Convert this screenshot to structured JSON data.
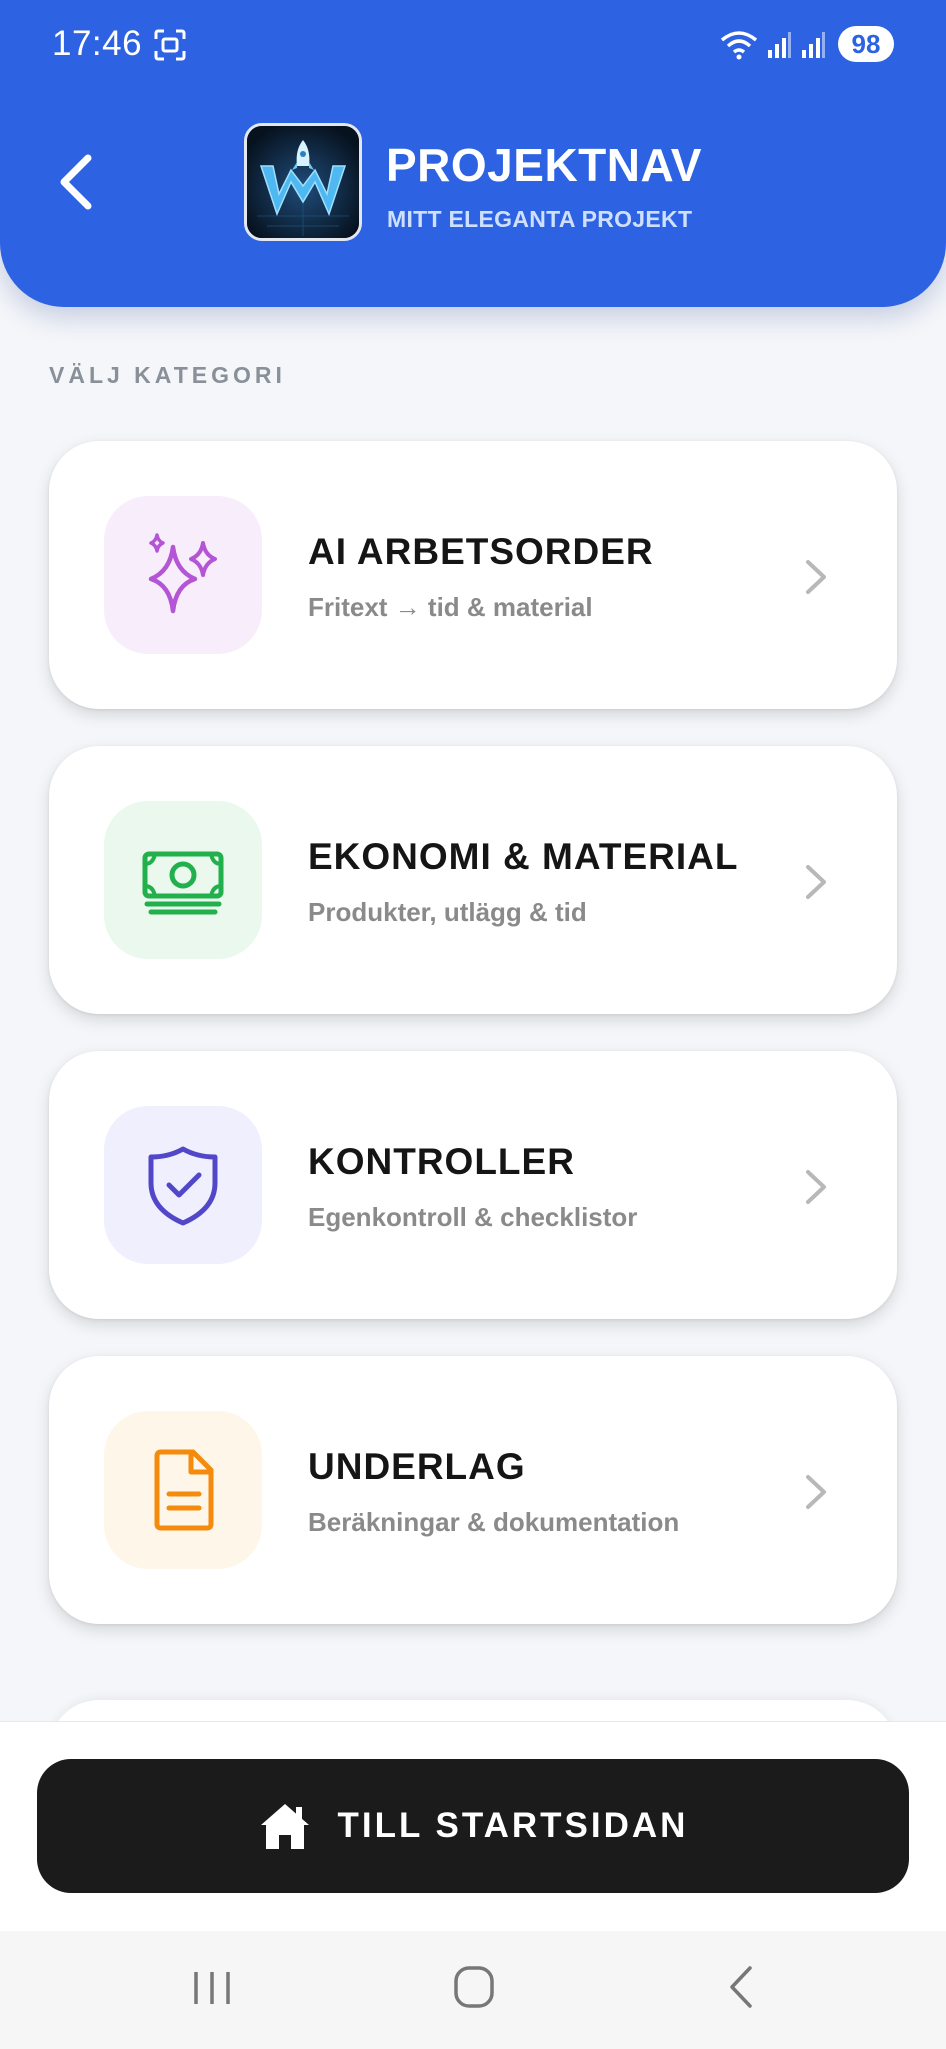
{
  "status_bar": {
    "time": "17:46",
    "battery": "98"
  },
  "header": {
    "title": "PROJEKTNAV",
    "subtitle": "MITT ELEGANTA PROJEKT"
  },
  "section_label": "VÄLJ KATEGORI",
  "categories": [
    {
      "title": "AI ARBETSORDER",
      "subtitle": "Fritext → tid & material",
      "icon": "sparkles-icon",
      "icon_color": "#b455d6",
      "icon_bg": "#f8eefb"
    },
    {
      "title": "EKONOMI & MATERIAL",
      "subtitle": "Produkter, utlägg & tid",
      "icon": "money-icon",
      "icon_color": "#22b04c",
      "icon_bg": "#eaf8ee"
    },
    {
      "title": "KONTROLLER",
      "subtitle": "Egenkontroll & checklistor",
      "icon": "shield-check-icon",
      "icon_color": "#5247c8",
      "icon_bg": "#efeffd"
    },
    {
      "title": "UNDERLAG",
      "subtitle": "Beräkningar & dokumentation",
      "icon": "document-icon",
      "icon_color": "#f58b0c",
      "icon_bg": "#fff6ea"
    }
  ],
  "home_button": {
    "label": "TILL STARTSIDAN",
    "icon": "home-icon"
  },
  "colors": {
    "primary": "#2d63e2",
    "dark_button": "#1b1b1c",
    "background": "#f4f6f9"
  }
}
